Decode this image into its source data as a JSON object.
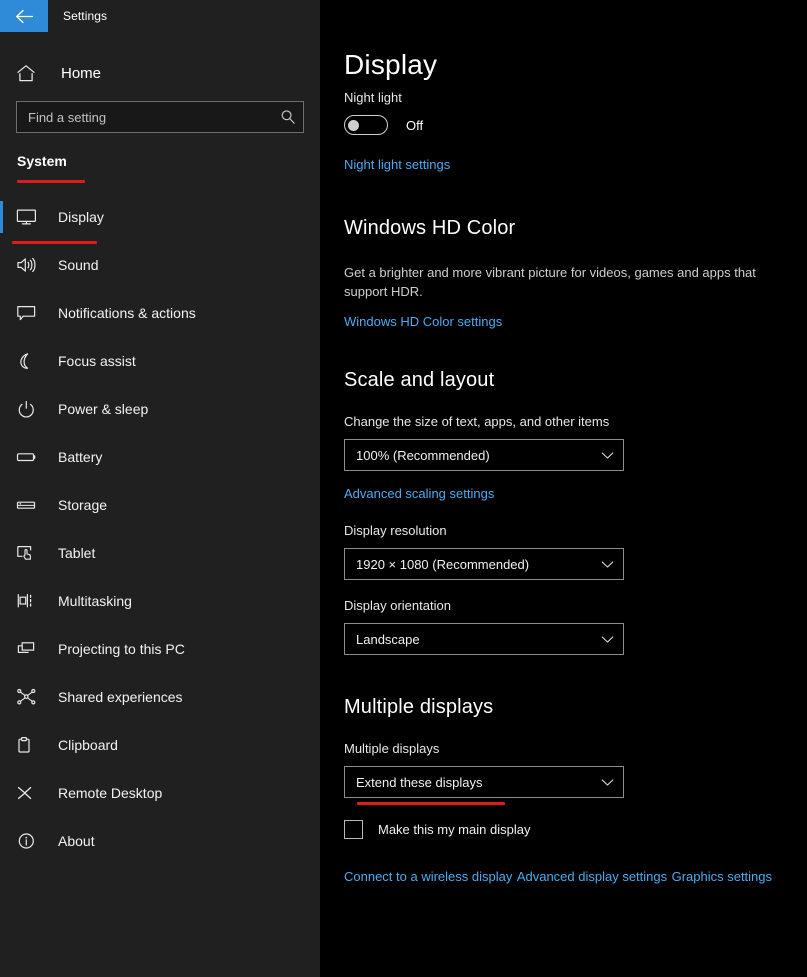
{
  "window": {
    "app_title": "Settings",
    "back_icon": "arrow-left-icon",
    "accent_color": "#2f8ad8",
    "annotation_color": "#e01b1b"
  },
  "sidebar": {
    "home": {
      "label": "Home",
      "icon": "home-icon"
    },
    "search": {
      "placeholder": "Find a setting",
      "value": "",
      "icon": "search-icon"
    },
    "section_title": "System",
    "items": [
      {
        "label": "Display",
        "icon": "monitor-icon",
        "selected": true
      },
      {
        "label": "Sound",
        "icon": "speaker-icon",
        "selected": false
      },
      {
        "label": "Notifications & actions",
        "icon": "chat-bubble-icon",
        "selected": false
      },
      {
        "label": "Focus assist",
        "icon": "moon-icon",
        "selected": false
      },
      {
        "label": "Power & sleep",
        "icon": "power-icon",
        "selected": false
      },
      {
        "label": "Battery",
        "icon": "battery-icon",
        "selected": false
      },
      {
        "label": "Storage",
        "icon": "storage-drive-icon",
        "selected": false
      },
      {
        "label": "Tablet",
        "icon": "tablet-hand-icon",
        "selected": false
      },
      {
        "label": "Multitasking",
        "icon": "multitasking-icon",
        "selected": false
      },
      {
        "label": "Projecting to this PC",
        "icon": "projecting-icon",
        "selected": false
      },
      {
        "label": "Shared experiences",
        "icon": "share-nodes-icon",
        "selected": false
      },
      {
        "label": "Clipboard",
        "icon": "clipboard-icon",
        "selected": false
      },
      {
        "label": "Remote Desktop",
        "icon": "remote-desktop-icon",
        "selected": false
      },
      {
        "label": "About",
        "icon": "info-circle-icon",
        "selected": false
      }
    ]
  },
  "main": {
    "page_title": "Display",
    "night_light": {
      "label": "Night light",
      "state": "Off",
      "settings_link": "Night light settings"
    },
    "hd_color": {
      "heading": "Windows HD Color",
      "description": "Get a brighter and more vibrant picture for videos, games and apps that support HDR.",
      "settings_link": "Windows HD Color settings"
    },
    "scale_and_layout": {
      "heading": "Scale and layout",
      "scale_label": "Change the size of text, apps, and other items",
      "scale_value": "100% (Recommended)",
      "advanced_scaling_link": "Advanced scaling settings",
      "resolution_label": "Display resolution",
      "resolution_value": "1920 × 1080 (Recommended)",
      "orientation_label": "Display orientation",
      "orientation_value": "Landscape"
    },
    "multiple_displays": {
      "heading": "Multiple displays",
      "label": "Multiple displays",
      "value": "Extend these displays",
      "main_display_checkbox_label": "Make this my main display",
      "main_display_checked": false,
      "links": [
        "Connect to a wireless display",
        "Advanced display settings",
        "Graphics settings"
      ]
    }
  }
}
